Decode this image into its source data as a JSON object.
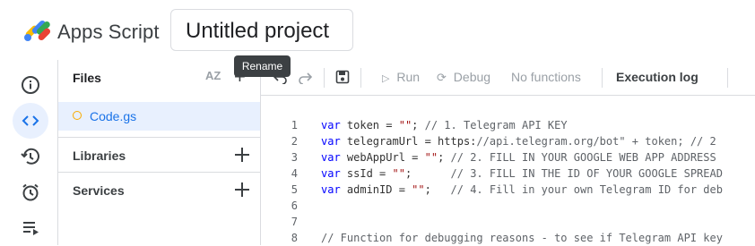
{
  "header": {
    "app_name": "Apps Script",
    "project_title": "Untitled project"
  },
  "tooltip": {
    "text": "Rename"
  },
  "rail": [
    "info-icon",
    "code-icon",
    "history-icon",
    "alarm-icon",
    "executions-icon"
  ],
  "files": {
    "title": "Files",
    "sort_label": "AZ",
    "items": [
      {
        "name": "Code.gs"
      }
    ],
    "libraries_label": "Libraries",
    "services_label": "Services"
  },
  "toolbar": {
    "run_label": "Run",
    "debug_label": "Debug",
    "function_select": "No functions",
    "execution_log_label": "Execution log"
  },
  "editor": {
    "line_numbers": [
      "1",
      "2",
      "3",
      "4",
      "5",
      "6",
      "7",
      "8"
    ],
    "lines": [
      "var token = \"\"; // 1. Telegram API KEY",
      "var telegramUrl = \"https://api.telegram.org/bot\" + token; // 2",
      "var webAppUrl = \"\"; // 2. FILL IN YOUR GOOGLE WEB APP ADDRESS",
      "var ssId = \"\";      // 3. FILL IN THE ID OF YOUR GOOGLE SPREAD",
      "var adminID = \"\";   // 4. Fill in your own Telegram ID for deb",
      "",
      "",
      "// Function for debugging reasons - to see if Telegram API key"
    ]
  }
}
